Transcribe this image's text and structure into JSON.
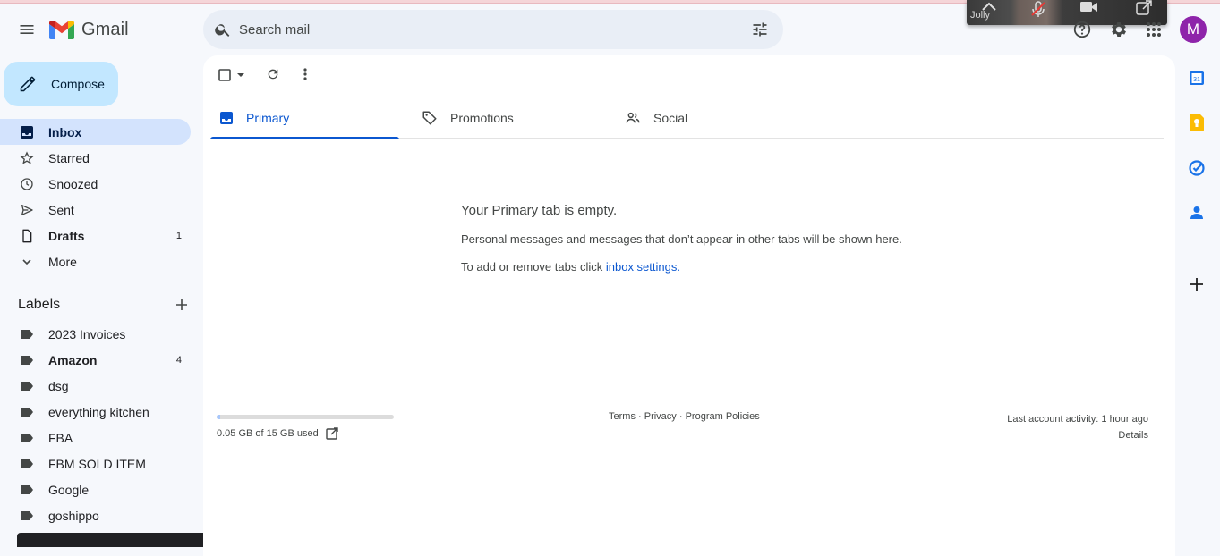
{
  "header": {
    "app_name": "Gmail",
    "search_placeholder": "Search mail",
    "avatar_letter": "M"
  },
  "video_overlay": {
    "name": "Jolly"
  },
  "compose": {
    "label": "Compose"
  },
  "nav": {
    "items": [
      {
        "label": "Inbox",
        "count": "",
        "icon": "inbox-icon"
      },
      {
        "label": "Starred",
        "count": "",
        "icon": "star-icon"
      },
      {
        "label": "Snoozed",
        "count": "",
        "icon": "clock-icon"
      },
      {
        "label": "Sent",
        "count": "",
        "icon": "send-icon"
      },
      {
        "label": "Drafts",
        "count": "1",
        "icon": "draft-icon"
      },
      {
        "label": "More",
        "count": "",
        "icon": "chevron-down-icon"
      }
    ]
  },
  "labels": {
    "title": "Labels",
    "items": [
      {
        "label": "2023 Invoices",
        "count": ""
      },
      {
        "label": "Amazon",
        "count": "4"
      },
      {
        "label": "dsg",
        "count": ""
      },
      {
        "label": "everything kitchen",
        "count": ""
      },
      {
        "label": "FBA",
        "count": ""
      },
      {
        "label": "FBM SOLD ITEM",
        "count": ""
      },
      {
        "label": "Google",
        "count": ""
      },
      {
        "label": "goshippo",
        "count": ""
      }
    ]
  },
  "tabs": [
    {
      "label": "Primary",
      "icon": "inbox-tab-icon"
    },
    {
      "label": "Promotions",
      "icon": "tag-icon"
    },
    {
      "label": "Social",
      "icon": "people-icon"
    }
  ],
  "empty_state": {
    "title": "Your Primary tab is empty.",
    "description": "Personal messages and messages that don’t appear in other tabs will be shown here.",
    "settings_prefix": "To add or remove tabs click ",
    "settings_link": "inbox settings",
    "settings_suffix": "."
  },
  "footer": {
    "storage_text": "0.05 GB of 15 GB used",
    "storage_fraction": 0.0033,
    "terms": "Terms",
    "privacy": "Privacy",
    "program_policies": "Program Policies",
    "separator": " · ",
    "last_activity": "Last account activity: 1 hour ago",
    "details": "Details"
  },
  "colors": {
    "accent": "#0b57d0",
    "compose_bg": "#c2e7ff",
    "active_nav_bg": "#d3e3fd",
    "avatar_bg": "#8e24aa"
  }
}
